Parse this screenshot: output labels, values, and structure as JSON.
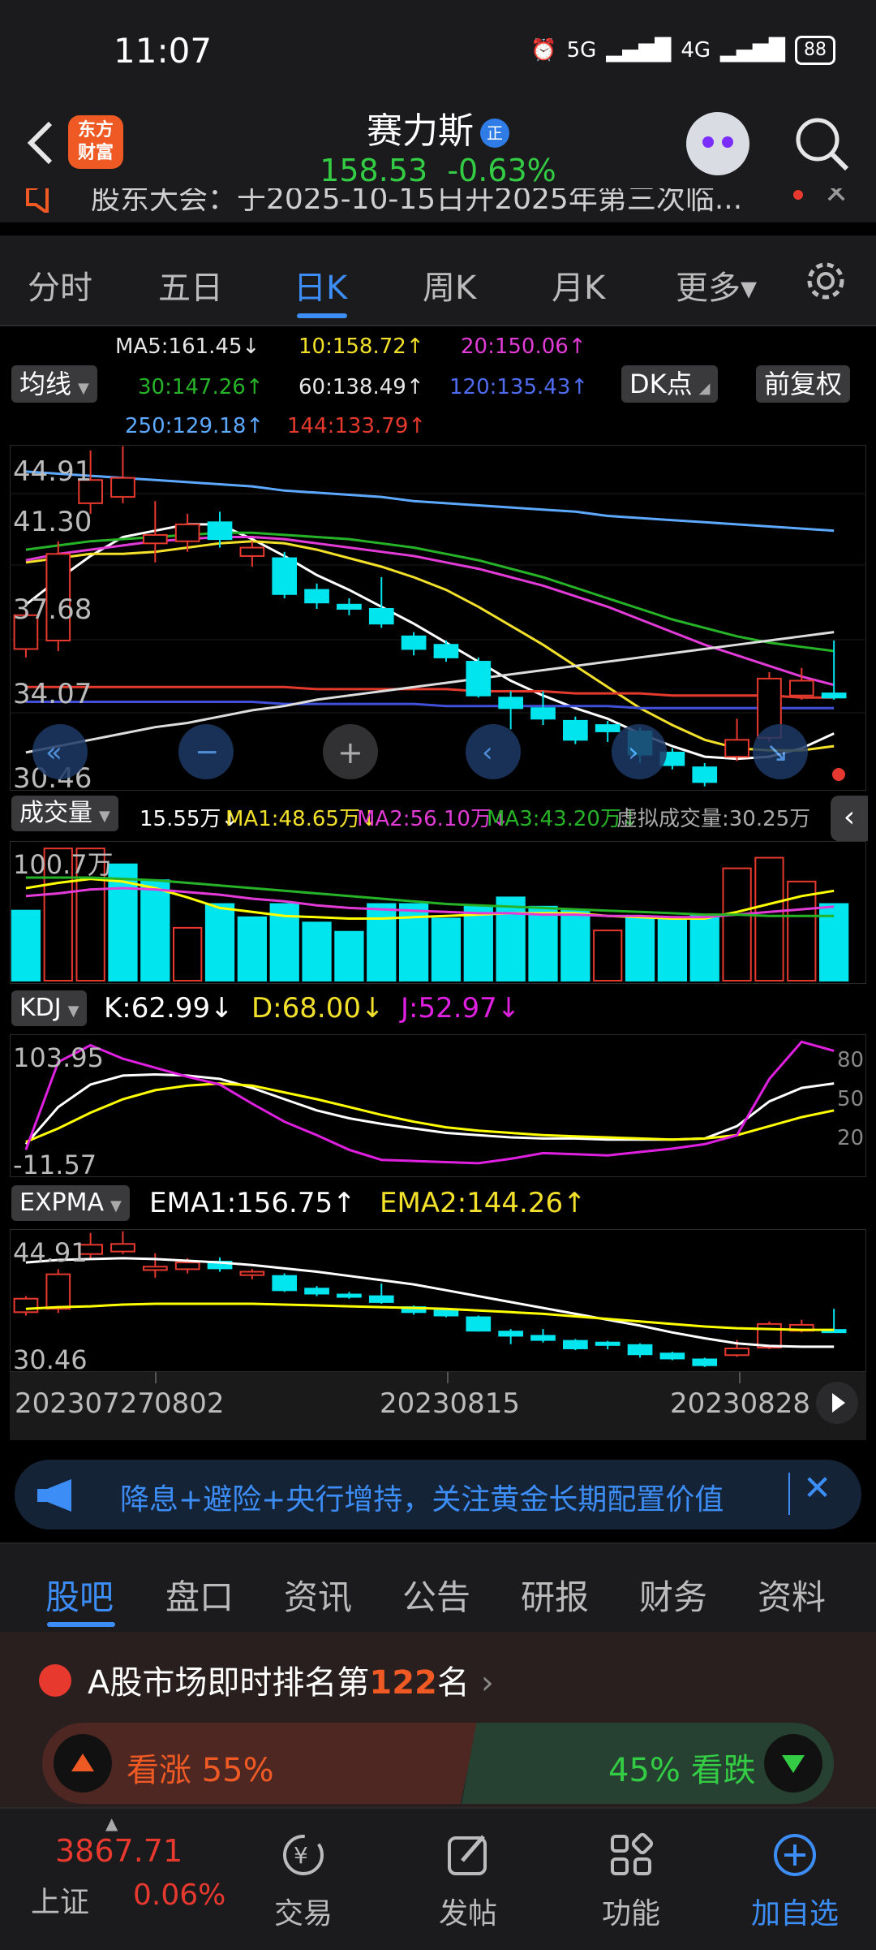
{
  "status_bar": {
    "time": "11:07",
    "signal_1": "5G",
    "signal_2": "4G",
    "battery": "88"
  },
  "header": {
    "logo_line1": "东方",
    "logo_line2": "财富",
    "stock_name": "赛力斯",
    "stock_badge": "正",
    "price": "158.53",
    "change_pct": "-0.63%",
    "ticker_text": "股东大会：于2025-10-15日开2025年第三次临..."
  },
  "period_tabs": [
    "分时",
    "五日",
    "日K",
    "周K",
    "月K",
    "更多▾"
  ],
  "active_period_tab": "日K",
  "ma_indicators": {
    "ma5": "MA5:161.45↓",
    "ma10": "10:158.72↑",
    "ma20": "20:150.06↑",
    "ma30": "30:147.26↑",
    "ma60": "60:138.49↑",
    "ma120": "120:135.43↑",
    "ma250": "250:129.18↑",
    "ma144": "144:133.79↑",
    "mode_label": "均线",
    "dk_label": "DK点",
    "fq_label": "前复权"
  },
  "kline_axis": [
    "44.91",
    "41.30",
    "37.68",
    "34.07",
    "30.46"
  ],
  "volume": {
    "label": "成交量",
    "current": "15.55万↓",
    "ma1": "MA1:48.65万↓",
    "ma2": "MA2:56.10万↓",
    "ma3": "MA3:43.20万↓",
    "virtual": "虚拟成交量:30.25万",
    "axis_max": "100.7万"
  },
  "kdj": {
    "label": "KDJ",
    "k": "K:62.99↓",
    "d": "D:68.00↓",
    "j": "J:52.97↓",
    "axis_top": "103.95",
    "axis_bottom": "-11.57",
    "levels": [
      "80",
      "50",
      "20"
    ]
  },
  "expma": {
    "label": "EXPMA",
    "ema1": "EMA1:156.75↑",
    "ema2": "EMA2:144.26↑",
    "axis_top": "44.91",
    "axis_bottom": "30.46"
  },
  "dates": [
    "20230727",
    "0802",
    "20230815",
    "20230828"
  ],
  "banner_text": "降息+避险+央行增持，关注黄金长期配置价值",
  "info_tabs": [
    "股吧",
    "盘口",
    "资讯",
    "公告",
    "研报",
    "财务",
    "资料"
  ],
  "active_info_tab": "股吧",
  "ranking": {
    "prefix": "A股市场即时排名第",
    "rank": "122",
    "suffix": "名"
  },
  "vote": {
    "up_label": "看涨 55%",
    "down_label": "45% 看跌",
    "up_fraction": 0.55
  },
  "bottom_nav": {
    "index_value": "3867.71",
    "index_name": "上证",
    "index_change": "0.06%",
    "trade": "交易",
    "post": "发帖",
    "functions": "功能",
    "add_watch": "加自选"
  },
  "colors": {
    "up": "#e8392f",
    "down": "#00e5ee",
    "accent": "#3d8df6",
    "green_text": "#33cc44"
  },
  "chart_data": [
    {
      "type": "candlestick",
      "series_values_note": "",
      "ylim": [
        30.46,
        44.91
      ],
      "candles": [
        {
          "o": 36.4,
          "c": 38.0,
          "h": 38.3,
          "l": 36.0
        },
        {
          "o": 36.8,
          "c": 40.9,
          "h": 41.5,
          "l": 36.3
        },
        {
          "o": 43.3,
          "c": 44.4,
          "h": 45.8,
          "l": 42.8
        },
        {
          "o": 43.6,
          "c": 44.5,
          "h": 46.0,
          "l": 43.3
        },
        {
          "o": 41.4,
          "c": 41.8,
          "h": 43.4,
          "l": 40.5
        },
        {
          "o": 41.5,
          "c": 42.3,
          "h": 42.8,
          "l": 41.0
        },
        {
          "o": 42.4,
          "c": 41.6,
          "h": 42.9,
          "l": 41.2
        },
        {
          "o": 40.8,
          "c": 41.2,
          "h": 41.5,
          "l": 40.3
        },
        {
          "o": 40.7,
          "c": 39.0,
          "h": 41.0,
          "l": 38.8
        },
        {
          "o": 39.2,
          "c": 38.6,
          "h": 39.5,
          "l": 38.3
        },
        {
          "o": 38.5,
          "c": 38.3,
          "h": 38.8,
          "l": 38.0
        },
        {
          "o": 38.3,
          "c": 37.6,
          "h": 39.8,
          "l": 37.4
        },
        {
          "o": 37.0,
          "c": 36.4,
          "h": 37.2,
          "l": 36.1
        },
        {
          "o": 36.6,
          "c": 36.0,
          "h": 36.8,
          "l": 35.8
        },
        {
          "o": 35.8,
          "c": 34.2,
          "h": 36.0,
          "l": 34.1
        },
        {
          "o": 34.1,
          "c": 33.6,
          "h": 34.4,
          "l": 32.6
        },
        {
          "o": 33.6,
          "c": 33.1,
          "h": 34.4,
          "l": 32.8
        },
        {
          "o": 33.0,
          "c": 32.1,
          "h": 33.2,
          "l": 31.9
        },
        {
          "o": 32.8,
          "c": 32.5,
          "h": 33.0,
          "l": 32.0
        },
        {
          "o": 32.5,
          "c": 31.4,
          "h": 32.7,
          "l": 31.0
        },
        {
          "o": 31.5,
          "c": 30.9,
          "h": 31.7,
          "l": 30.7
        },
        {
          "o": 30.8,
          "c": 30.1,
          "h": 31.0,
          "l": 29.9
        },
        {
          "o": 31.3,
          "c": 32.1,
          "h": 33.1,
          "l": 31.1
        },
        {
          "o": 32.2,
          "c": 35.0,
          "h": 35.3,
          "l": 32.0
        },
        {
          "o": 34.2,
          "c": 34.9,
          "h": 35.5,
          "l": 34.0
        },
        {
          "o": 34.3,
          "c": 34.1,
          "h": 36.8,
          "l": 34.0
        }
      ],
      "ma_lines": [
        {
          "color": "#ffffff",
          "values": [
            38.5,
            39.7,
            40.8,
            41.7,
            42.0,
            42.3,
            42.3,
            41.6,
            40.8,
            39.9,
            39.2,
            38.4,
            37.6,
            36.7,
            35.8,
            34.9,
            34.2,
            33.6,
            33.1,
            32.4,
            31.8,
            31.3,
            31.2,
            31.3,
            31.7,
            32.4
          ]
        },
        {
          "color": "#f2e02a",
          "values": [
            40.5,
            40.7,
            40.9,
            40.9,
            41.0,
            41.2,
            41.4,
            41.5,
            41.4,
            41.1,
            40.7,
            40.3,
            39.8,
            39.2,
            38.4,
            37.5,
            36.6,
            35.6,
            34.6,
            33.6,
            32.8,
            32.1,
            31.7,
            31.6,
            31.6,
            31.8
          ]
        },
        {
          "color": "#e23bd7",
          "values": [
            40.6,
            40.9,
            41.1,
            41.3,
            41.5,
            41.6,
            41.7,
            41.7,
            41.6,
            41.4,
            41.2,
            41.0,
            40.8,
            40.5,
            40.2,
            39.8,
            39.4,
            38.9,
            38.4,
            37.8,
            37.2,
            36.6,
            36.1,
            35.6,
            35.1,
            34.7
          ]
        },
        {
          "color": "#27b327",
          "values": [
            41.1,
            41.3,
            41.5,
            41.6,
            41.7,
            41.8,
            41.9,
            41.9,
            41.8,
            41.7,
            41.6,
            41.4,
            41.2,
            40.9,
            40.6,
            40.2,
            39.8,
            39.3,
            38.8,
            38.3,
            37.8,
            37.4,
            37.0,
            36.7,
            36.5,
            36.3
          ]
        },
        {
          "color": "#5da9ff",
          "values": [
            44.8,
            44.7,
            44.6,
            44.5,
            44.4,
            44.3,
            44.2,
            44.1,
            43.9,
            43.8,
            43.7,
            43.6,
            43.4,
            43.3,
            43.2,
            43.1,
            43.0,
            42.9,
            42.7,
            42.6,
            42.5,
            42.4,
            42.3,
            42.2,
            42.1,
            42.0
          ]
        },
        {
          "color": "#e33a2d",
          "values": [
            34.6,
            34.6,
            34.6,
            34.6,
            34.6,
            34.6,
            34.6,
            34.6,
            34.6,
            34.5,
            34.5,
            34.5,
            34.5,
            34.5,
            34.4,
            34.4,
            34.4,
            34.3,
            34.3,
            34.3,
            34.2,
            34.2,
            34.2,
            34.2,
            34.1,
            34.1
          ]
        },
        {
          "color": "#4050d8",
          "values": [
            33.9,
            33.9,
            33.9,
            33.9,
            33.9,
            33.9,
            33.9,
            33.9,
            33.8,
            33.8,
            33.8,
            33.8,
            33.8,
            33.7,
            33.7,
            33.7,
            33.7,
            33.7,
            33.7,
            33.6,
            33.6,
            33.6,
            33.6,
            33.6,
            33.6,
            33.6
          ]
        },
        {
          "color": "#dddddd",
          "values": [
            31.5,
            31.8,
            32.1,
            32.4,
            32.7,
            32.9,
            33.2,
            33.5,
            33.7,
            34.0,
            34.2,
            34.4,
            34.6,
            34.8,
            35.0,
            35.2,
            35.4,
            35.6,
            35.8,
            36.0,
            36.2,
            36.4,
            36.6,
            36.8,
            37.0,
            37.2
          ]
        }
      ]
    },
    {
      "type": "bar",
      "ylim": [
        0,
        100.7
      ],
      "values": [
        53,
        100,
        100,
        88,
        76,
        40,
        58,
        48,
        58,
        44,
        37,
        58,
        58,
        47,
        56,
        63,
        56,
        53,
        38,
        47,
        47,
        50,
        85,
        93,
        75,
        58
      ],
      "up": [
        false,
        true,
        true,
        false,
        false,
        true,
        false,
        false,
        false,
        false,
        false,
        false,
        false,
        false,
        false,
        false,
        false,
        false,
        true,
        false,
        false,
        false,
        true,
        true,
        true,
        false
      ],
      "ma_lines": [
        {
          "color": "#ffff00",
          "values": [
            70,
            74,
            77,
            75,
            70,
            63,
            55,
            52,
            49,
            48,
            47,
            47,
            48,
            49,
            50,
            51,
            51,
            51,
            49,
            48,
            47,
            47,
            52,
            58,
            64,
            68
          ]
        },
        {
          "color": "#e23bd7",
          "values": [
            64,
            66,
            69,
            70,
            69,
            67,
            65,
            62,
            60,
            57,
            55,
            54,
            53,
            52,
            51,
            51,
            50,
            50,
            49,
            49,
            48,
            48,
            50,
            52,
            54,
            56
          ]
        },
        {
          "color": "#27b327",
          "values": [
            78,
            78,
            78,
            77,
            76,
            74,
            72,
            70,
            68,
            66,
            64,
            62,
            60,
            58,
            57,
            56,
            55,
            54,
            53,
            52,
            51,
            50,
            50,
            49,
            49,
            49
          ]
        }
      ]
    },
    {
      "type": "line",
      "ylim": [
        -11.57,
        103.95
      ],
      "series": [
        {
          "color": "#ffffff",
          "values": [
            12,
            45,
            65,
            73,
            74,
            73,
            70,
            62,
            52,
            42,
            35,
            30,
            26,
            22,
            20,
            18,
            17,
            17,
            16,
            16,
            16,
            17,
            28,
            50,
            62,
            66
          ]
        },
        {
          "color": "#ffff00",
          "values": [
            14,
            26,
            40,
            52,
            60,
            64,
            66,
            64,
            58,
            52,
            45,
            38,
            32,
            27,
            24,
            22,
            20,
            19,
            18,
            17,
            16,
            17,
            20,
            28,
            36,
            42
          ]
        },
        {
          "color": "#e020e0",
          "values": [
            7,
            85,
            100,
            88,
            80,
            72,
            65,
            48,
            32,
            20,
            7,
            -2,
            -3,
            -4,
            -5,
            -1,
            4,
            3,
            2,
            5,
            8,
            12,
            20,
            70,
            103,
            95
          ]
        }
      ]
    },
    {
      "type": "line",
      "ylim": [
        30.46,
        44.91
      ],
      "series": [
        {
          "color": "#ffffff",
          "values": [
            42.3,
            42.6,
            42.7,
            42.8,
            42.7,
            42.5,
            42.3,
            42.0,
            41.6,
            41.2,
            40.7,
            40.2,
            39.7,
            39.0,
            38.3,
            37.6,
            36.9,
            36.2,
            35.5,
            34.8,
            34.0,
            33.3,
            32.7,
            32.4,
            32.3,
            32.3
          ]
        },
        {
          "color": "#ffff00",
          "values": [
            36.8,
            37.0,
            37.1,
            37.3,
            37.4,
            37.4,
            37.4,
            37.4,
            37.3,
            37.2,
            37.1,
            37.0,
            36.9,
            36.8,
            36.6,
            36.4,
            36.2,
            35.9,
            35.6,
            35.3,
            35.0,
            34.7,
            34.5,
            34.4,
            34.3,
            34.3
          ]
        }
      ]
    }
  ]
}
